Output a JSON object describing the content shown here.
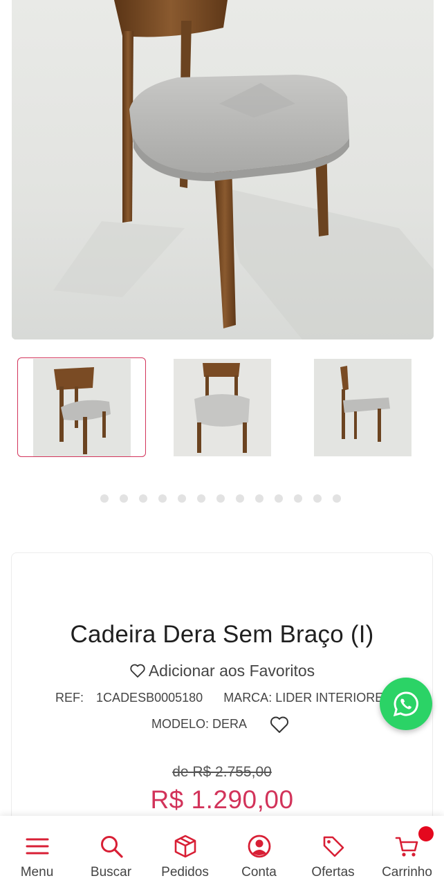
{
  "gallery": {
    "main_image_alt": "Cadeira Dera Sem Braço - vista principal",
    "thumbnails": [
      {
        "name": "thumb-front-angle",
        "active": true
      },
      {
        "name": "thumb-front",
        "active": false
      },
      {
        "name": "thumb-side",
        "active": false
      }
    ],
    "dot_count": 13
  },
  "product": {
    "title": "Cadeira Dera Sem Braço (I)",
    "favorite_label": "Adicionar aos Favoritos",
    "ref_label": "REF:",
    "ref_value": "1CADESB0005180",
    "brand_label": "MARCA:",
    "brand_value": "LIDER INTERIORES",
    "model_label": "MODELO:",
    "model_value": "DERA",
    "old_price": "de R$ 2.755,00",
    "price": "R$ 1.290,00"
  },
  "whatsapp": {
    "icon": "whatsapp-icon"
  },
  "bottom_nav": {
    "items": [
      {
        "label": "Menu",
        "icon": "menu-icon"
      },
      {
        "label": "Buscar",
        "icon": "search-icon"
      },
      {
        "label": "Pedidos",
        "icon": "box-icon"
      },
      {
        "label": "Conta",
        "icon": "user-icon"
      },
      {
        "label": "Ofertas",
        "icon": "tag-icon"
      },
      {
        "label": "Carrinho",
        "icon": "cart-icon"
      }
    ]
  },
  "colors": {
    "accent": "#d2335a",
    "nav_icon": "#d81f35",
    "whatsapp": "#2bd366",
    "badge": "#e4081e"
  }
}
